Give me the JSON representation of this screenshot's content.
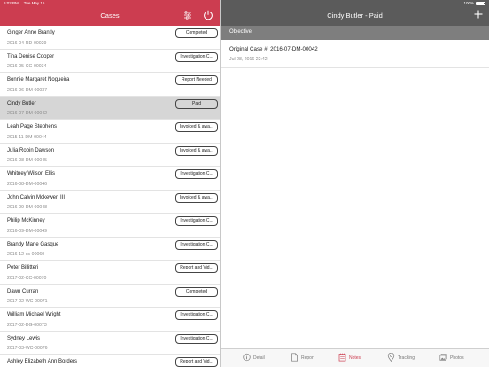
{
  "status_bar": {
    "time": "6:02 PM",
    "date": "Tue May 16",
    "battery": "100%"
  },
  "left_header": {
    "title": "Cases",
    "filter_icon": "sliders-icon",
    "power_icon": "power-icon"
  },
  "cases": [
    {
      "name": "Ginger Anne Brantly",
      "id": "2016-04-RD-00029",
      "status": "Completed"
    },
    {
      "name": "Tina Denise Cooper",
      "id": "2016-05-CC-00034",
      "status": "Investigation C..."
    },
    {
      "name": "Bonnie Margaret Nogueira",
      "id": "2016-06-DM-00037",
      "status": "Report Needed"
    },
    {
      "name": "Cindy Butler",
      "id": "2016-07-DM-00042",
      "status": "Paid"
    },
    {
      "name": "Leah Page Stephens",
      "id": "2015-11-DM-00044",
      "status": "Invoiced & awa..."
    },
    {
      "name": "Julia Robin Dawson",
      "id": "2016-08-DM-00045",
      "status": "Invoiced & awa..."
    },
    {
      "name": "Whitney Wilson Ellis",
      "id": "2016-08-DM-00046",
      "status": "Investigation C..."
    },
    {
      "name": "John Calvin Mckewen III",
      "id": "2016-09-DM-00048",
      "status": "Invoiced & awa..."
    },
    {
      "name": "Philip McKinney",
      "id": "2016-09-DM-00049",
      "status": "Investigation C..."
    },
    {
      "name": "Brandy Mane Gasque",
      "id": "2016-12-cs-00060",
      "status": "Investigation C..."
    },
    {
      "name": "Peter Billitteri",
      "id": "2017-02-CC-00070",
      "status": "Report and Vid..."
    },
    {
      "name": "Dawn Curran",
      "id": "2017-02-WC-00071",
      "status": "Completed"
    },
    {
      "name": "William Michael Wright",
      "id": "2017-02-DG-00073",
      "status": "Investigation C..."
    },
    {
      "name": "Sydney Lewis",
      "id": "2017-03-WC-00076",
      "status": "Investigation C..."
    },
    {
      "name": "Ashley Elizabeth Ann Borders",
      "id": "",
      "status": "Report and Vid..."
    }
  ],
  "selected_case_index": 3,
  "right_header": {
    "title": "Cindy Butler - Paid",
    "add_icon": "plus-icon"
  },
  "section": {
    "label": "Objective"
  },
  "note": {
    "title": "Original Case #: 2016-07-DM-00042",
    "date": "Jul 28, 2016 22:42"
  },
  "tabs": [
    {
      "label": "Detail",
      "icon": "info-icon",
      "active": false
    },
    {
      "label": "Report",
      "icon": "document-icon",
      "active": false
    },
    {
      "label": "Notes",
      "icon": "notes-icon",
      "active": true
    },
    {
      "label": "Tracking",
      "icon": "location-pin-icon",
      "active": false
    },
    {
      "label": "Photos",
      "icon": "photos-icon",
      "active": false
    }
  ],
  "colors": {
    "accent": "#cc3d50",
    "right_header": "#5b5b5b",
    "section_bar": "#7e7e7e",
    "selected_row": "#d6d6d6"
  }
}
